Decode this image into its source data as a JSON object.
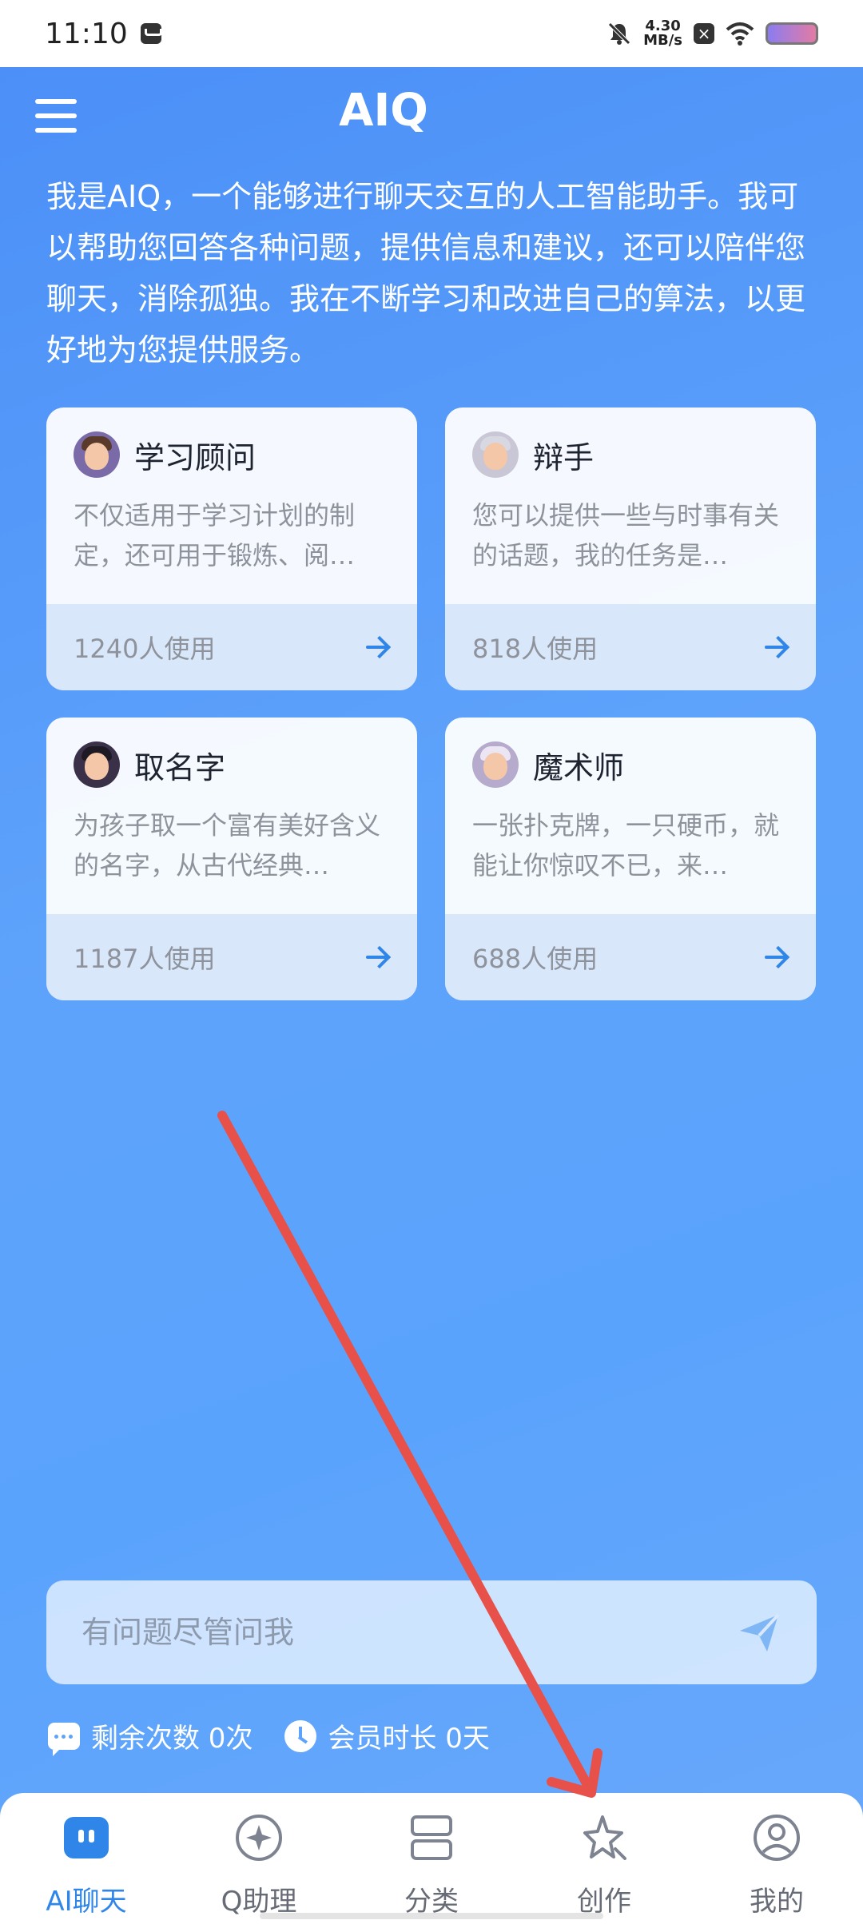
{
  "status_bar": {
    "time": "11:10",
    "speed_value": "4.30",
    "speed_unit": "MB/s"
  },
  "header": {
    "title": "AIQ"
  },
  "intro": "我是AIQ，一个能够进行聊天交互的人工智能助手。我可以帮助您回答各种问题，提供信息和建议，还可以陪伴您聊天，消除孤独。我在不断学习和改进自己的算法，以更好地为您提供服务。",
  "cards": [
    {
      "title": "学习顾问",
      "desc": "不仅适用于学习计划的制定，还可用于锻炼、阅…",
      "count": "1240人使用",
      "avatar_color": "#7b6aa8"
    },
    {
      "title": "辩手",
      "desc": "您可以提供一些与时事有关的话题，我的任务是…",
      "count": "818人使用",
      "avatar_color": "#c9c6d6"
    },
    {
      "title": "取名字",
      "desc": "为孩子取一个富有美好含义的名字，从古代经典…",
      "count": "1187人使用",
      "avatar_color": "#3a3148"
    },
    {
      "title": "魔术师",
      "desc": "一张扑克牌，一只硬币，就能让你惊叹不已，来…",
      "count": "688人使用",
      "avatar_color": "#b6aacd"
    }
  ],
  "input": {
    "placeholder": "有问题尽管问我"
  },
  "quota": {
    "remaining": "剩余次数 0次",
    "membership": "会员时长 0天"
  },
  "nav": [
    {
      "label": "AI聊天",
      "icon": "chat-bubble-icon",
      "active": true
    },
    {
      "label": "Q助理",
      "icon": "compass-icon",
      "active": false
    },
    {
      "label": "分类",
      "icon": "category-icon",
      "active": false
    },
    {
      "label": "创作",
      "icon": "star-pen-icon",
      "active": false
    },
    {
      "label": "我的",
      "icon": "user-icon",
      "active": false
    }
  ],
  "colors": {
    "accent": "#2f86e8",
    "background_top": "#4a8ef7",
    "annotation_arrow": "#e8504a"
  }
}
